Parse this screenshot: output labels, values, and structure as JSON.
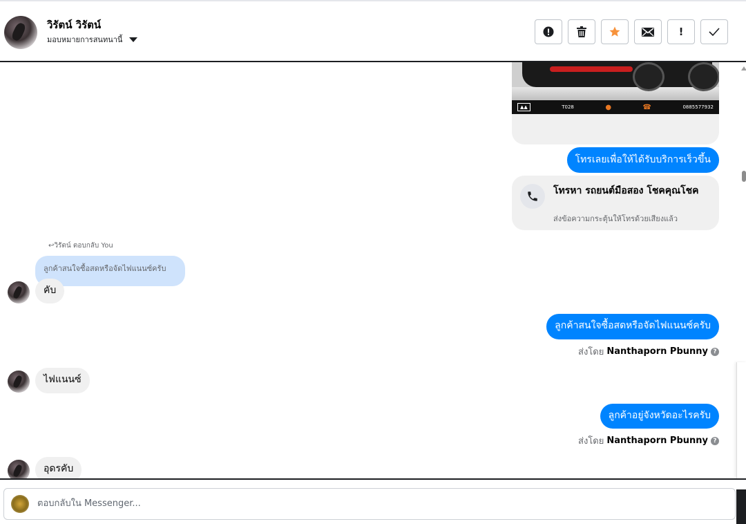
{
  "header": {
    "contact_name": "วิรัตน์ วิรัตน์",
    "assignment_label": "มอบหมายการสนทนานี้",
    "actions": [
      {
        "icon": "alert-circle-icon",
        "glyph": "●!",
        "name": "mark-spam-button"
      },
      {
        "icon": "trash-icon",
        "glyph": "🗑",
        "name": "delete-button"
      },
      {
        "icon": "star-icon",
        "glyph": "★",
        "name": "star-button",
        "color": "#f7923b"
      },
      {
        "icon": "envelope-icon",
        "glyph": "✉",
        "name": "mark-unread-button"
      },
      {
        "icon": "exclamation-icon",
        "glyph": "!",
        "name": "follow-up-button"
      },
      {
        "icon": "checkmark-icon",
        "glyph": "✓",
        "name": "mark-done-button"
      }
    ]
  },
  "thread": {
    "card_band": {
      "tag": "T028",
      "phone": "0885577932"
    },
    "messages": {
      "cta_bubble": "โทรเลยเพื่อให้ได้รับบริการเร็วขึ้น",
      "call_card_title": "โทรหา รถยนต์มือสอง โชคคุณโชค",
      "call_card_subtitle": "ส่งข้อความกระตุ้นให้โทรด้วยเสียงแล้ว",
      "reply_meta": "↩วิรัตน์ ตอบกลับ You",
      "quoted_text": "ลูกค้าสนใจซื้อสดหรือจัดไฟแนนซ์ครับ",
      "in_1": "คับ",
      "out_1": "ลูกค้าสนใจซื้อสดหรือจัดไฟแนนซ์ครับ",
      "sent_by_prefix": "ส่งโดย",
      "sent_by_name": "Nanthaporn Pbunny",
      "in_2": "ไฟแนนซ์",
      "out_2": "ลูกค้าอยู่จังหวัดอะไรครับ",
      "in_3": "อุดรคับ"
    }
  },
  "composer": {
    "placeholder": "ตอบกลับใน Messenger..."
  },
  "colors": {
    "outgoing_bubble": "#0084ff",
    "incoming_bubble": "#f0f0f0",
    "quoted_bubble": "#cfe3fc",
    "star": "#f7923b"
  }
}
